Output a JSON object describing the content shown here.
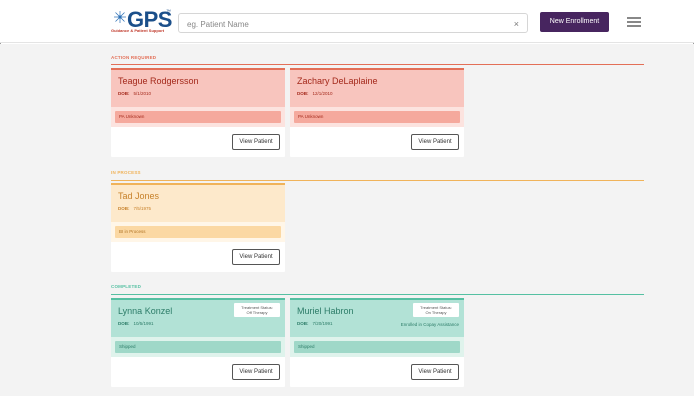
{
  "header": {
    "logo_text": "GPS",
    "logo_trademark": "™",
    "logo_subtitle": "Guidance & Patient Support",
    "search_placeholder": "eg. Patient Name",
    "search_clear": "×",
    "new_enrollment_label": "New Enrollment",
    "menu_icon": "hamburger-menu-icon"
  },
  "colors": {
    "brand_purple": "#47255f",
    "action_required": "#e36f57",
    "in_process": "#f0b35a",
    "completed": "#55c0a2"
  },
  "sections": {
    "action_required": {
      "label": "ACTION REQUIRED",
      "cards": [
        {
          "name": "Teague Rodgersson",
          "dob_label": "DOB:",
          "dob": "5/1/2010",
          "status": "PA Unknown",
          "button": "View Patient"
        },
        {
          "name": "Zachary DeLaplaine",
          "dob_label": "DOB:",
          "dob": "12/1/2010",
          "status": "PA Unknown",
          "button": "View Patient"
        }
      ]
    },
    "in_process": {
      "label": "IN PROCESS",
      "cards": [
        {
          "name": "Tad Jones",
          "dob_label": "DOB:",
          "dob": "7/5/1975",
          "status": "BI in Process",
          "button": "View Patient"
        }
      ]
    },
    "completed": {
      "label": "COMPLETED",
      "cards": [
        {
          "name": "Lynna Konzel",
          "dob_label": "DOB:",
          "dob": "10/5/1991",
          "tx_status_title": "Treatment Status:",
          "tx_status": "Off Therapy",
          "copay": "",
          "status": "Shipped",
          "button": "View Patient"
        },
        {
          "name": "Muriel Habron",
          "dob_label": "DOB:",
          "dob": "7/20/1991",
          "tx_status_title": "Treatment Status:",
          "tx_status": "On Therapy",
          "copay": "Enrolled in Copay Assistance",
          "status": "Shipped",
          "button": "View Patient"
        }
      ]
    }
  }
}
